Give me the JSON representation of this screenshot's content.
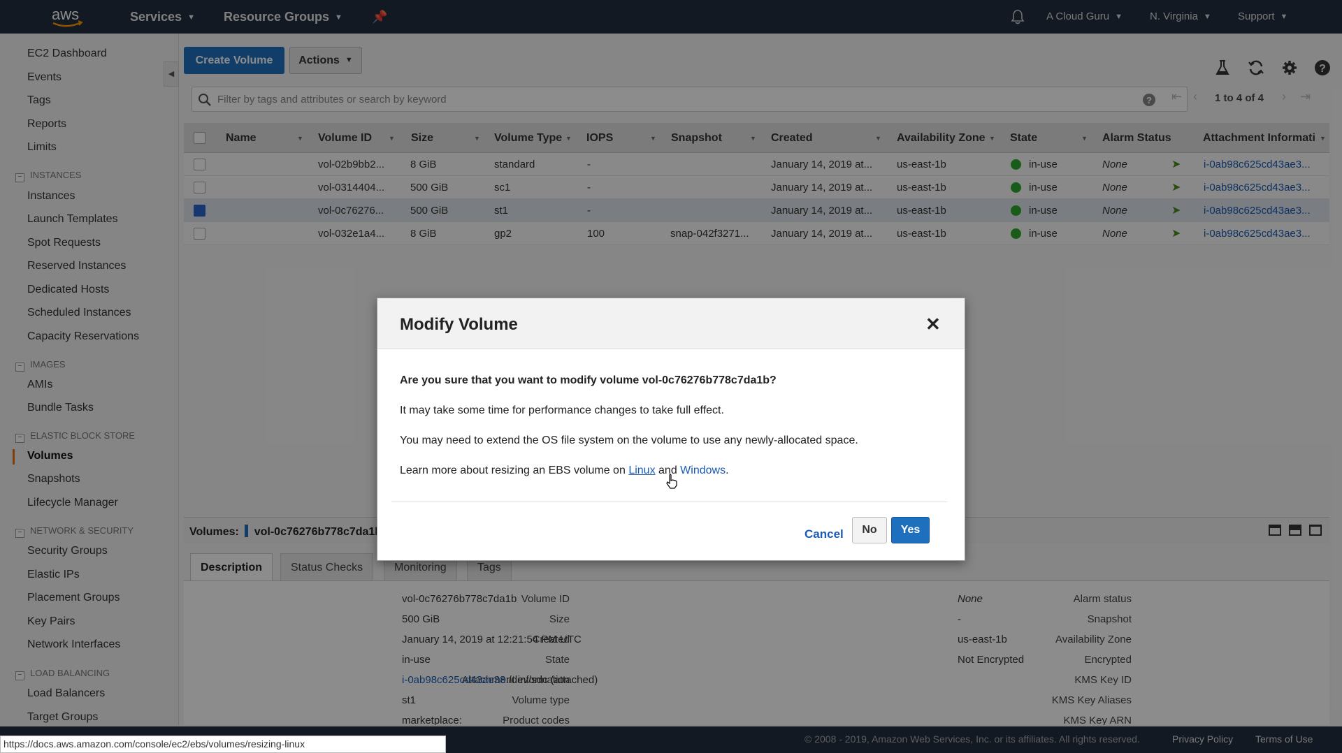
{
  "topbar": {
    "logo_text": "aws",
    "services": "Services",
    "resource_groups": "Resource Groups",
    "account": "A Cloud Guru",
    "region": "N. Virginia",
    "support": "Support"
  },
  "sidebar": {
    "items": [
      {
        "label": "EC2 Dashboard"
      },
      {
        "label": "Events"
      },
      {
        "label": "Tags"
      },
      {
        "label": "Reports"
      },
      {
        "label": "Limits"
      }
    ],
    "instances": {
      "heading": "INSTANCES",
      "items": [
        "Instances",
        "Launch Templates",
        "Spot Requests",
        "Reserved Instances",
        "Dedicated Hosts",
        "Scheduled Instances",
        "Capacity Reservations"
      ]
    },
    "images": {
      "heading": "IMAGES",
      "items": [
        "AMIs",
        "Bundle Tasks"
      ]
    },
    "ebs": {
      "heading": "ELASTIC BLOCK STORE",
      "items": [
        "Volumes",
        "Snapshots",
        "Lifecycle Manager"
      ]
    },
    "network": {
      "heading": "NETWORK & SECURITY",
      "items": [
        "Security Groups",
        "Elastic IPs",
        "Placement Groups",
        "Key Pairs",
        "Network Interfaces"
      ]
    },
    "load_balancing": {
      "heading": "LOAD BALANCING",
      "items": [
        "Load Balancers",
        "Target Groups"
      ]
    }
  },
  "toolbar": {
    "create_volume": "Create Volume",
    "actions": "Actions"
  },
  "filter": {
    "placeholder": "Filter by tags and attributes or search by keyword",
    "pager": "1 to 4 of 4"
  },
  "table": {
    "columns": [
      "Name",
      "Volume ID",
      "Size",
      "Volume Type",
      "IOPS",
      "Snapshot",
      "Created",
      "Availability Zone",
      "State",
      "Alarm Status",
      "Attachment Informati"
    ],
    "rows": [
      {
        "name": "",
        "volume_id": "vol-02b9bb2...",
        "size": "8 GiB",
        "type": "standard",
        "iops": "-",
        "snapshot": "",
        "created": "January 14, 2019 at...",
        "az": "us-east-1b",
        "state": "in-use",
        "alarm": "None",
        "attachment": "i-0ab98c625cd43ae3...",
        "selected": false
      },
      {
        "name": "",
        "volume_id": "vol-0314404...",
        "size": "500 GiB",
        "type": "sc1",
        "iops": "-",
        "snapshot": "",
        "created": "January 14, 2019 at...",
        "az": "us-east-1b",
        "state": "in-use",
        "alarm": "None",
        "attachment": "i-0ab98c625cd43ae3...",
        "selected": false
      },
      {
        "name": "",
        "volume_id": "vol-0c76276...",
        "size": "500 GiB",
        "type": "st1",
        "iops": "-",
        "snapshot": "",
        "created": "January 14, 2019 at...",
        "az": "us-east-1b",
        "state": "in-use",
        "alarm": "None",
        "attachment": "i-0ab98c625cd43ae3...",
        "selected": true
      },
      {
        "name": "",
        "volume_id": "vol-032e1a4...",
        "size": "8 GiB",
        "type": "gp2",
        "iops": "100",
        "snapshot": "snap-042f3271...",
        "created": "January 14, 2019 at...",
        "az": "us-east-1b",
        "state": "in-use",
        "alarm": "None",
        "attachment": "i-0ab98c625cd43ae3...",
        "selected": false
      }
    ]
  },
  "details": {
    "label_prefix": "Volumes:",
    "selected_volume": "vol-0c76276b778c7da1b",
    "tabs": [
      "Description",
      "Status Checks",
      "Monitoring",
      "Tags"
    ],
    "left": [
      {
        "label": "Volume ID",
        "value": "vol-0c76276b778c7da1b"
      },
      {
        "label": "Size",
        "value": "500 GiB"
      },
      {
        "label": "Created",
        "value": "January 14, 2019 at 12:21:54 PM UTC"
      },
      {
        "label": "State",
        "value": "in-use"
      },
      {
        "label": "Attachment information",
        "link": "i-0ab98c625cd43ae38",
        "value": ":/dev/sdc (attached)"
      },
      {
        "label": "Volume type",
        "value": "st1"
      },
      {
        "label": "Product codes",
        "value": "marketplace:"
      }
    ],
    "right": [
      {
        "label": "Alarm status",
        "value": "None"
      },
      {
        "label": "Snapshot",
        "value": "-"
      },
      {
        "label": "Availability Zone",
        "value": "us-east-1b"
      },
      {
        "label": "Encrypted",
        "value": "Not Encrypted"
      },
      {
        "label": "KMS Key ID",
        "value": ""
      },
      {
        "label": "KMS Key Aliases",
        "value": ""
      },
      {
        "label": "KMS Key ARN",
        "value": ""
      }
    ]
  },
  "modal": {
    "title": "Modify Volume",
    "question": "Are you sure that you want to modify volume vol-0c76276b778c7da1b?",
    "line1": "It may take some time for performance changes to take full effect.",
    "line2": "You may need to extend the OS file system on the volume to use any newly-allocated space.",
    "learn_prefix": "Learn more about resizing an EBS volume on",
    "linux": "Linux",
    "and": "and",
    "windows": "Windows",
    "period": ".",
    "cancel": "Cancel",
    "no": "No",
    "yes": "Yes"
  },
  "footer": {
    "copyright": "© 2008 - 2019, Amazon Web Services, Inc. or its affiliates. All rights reserved.",
    "privacy": "Privacy Policy",
    "terms": "Terms of Use"
  },
  "status_url": "https://docs.aws.amazon.com/console/ec2/ebs/volumes/resizing-linux",
  "colors": {
    "accent": "#1f6fbf",
    "nav_bg": "#232f3e",
    "active_marker": "#ec7211",
    "in_use": "#2fa82f"
  }
}
